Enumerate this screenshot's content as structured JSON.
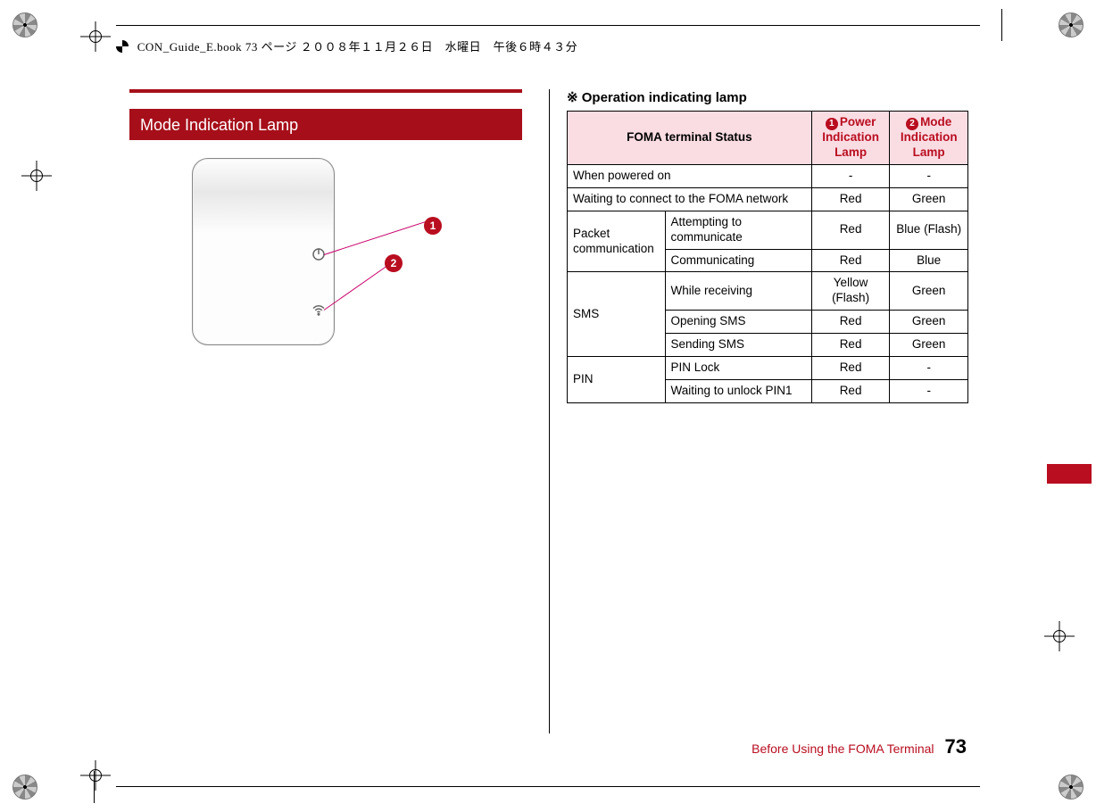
{
  "crop_header": "CON_Guide_E.book  73 ページ  ２００８年１１月２６日　水曜日　午後６時４３分",
  "left": {
    "title": "Mode Indication Lamp",
    "callouts": {
      "one": "1",
      "two": "2"
    }
  },
  "right": {
    "heading": "※ Operation indicating lamp",
    "columns": {
      "status": "FOMA terminal Status",
      "power_badge": "1",
      "power": "Power Indication Lamp",
      "mode_badge": "2",
      "mode": "Mode Indication Lamp"
    },
    "rows": [
      {
        "group": "",
        "status": "When powered on",
        "power": "-",
        "mode": "-"
      },
      {
        "group": "",
        "status": "Waiting to connect to the FOMA network",
        "power": "Red",
        "mode": "Green"
      },
      {
        "group": "Packet communication",
        "status": "Attempting to communicate",
        "power": "Red",
        "mode": "Blue (Flash)"
      },
      {
        "group": "",
        "status": "Communicating",
        "power": "Red",
        "mode": "Blue"
      },
      {
        "group": "SMS",
        "status": "While receiving",
        "power": "Yellow (Flash)",
        "mode": "Green"
      },
      {
        "group": "",
        "status": "Opening SMS",
        "power": "Red",
        "mode": "Green"
      },
      {
        "group": "",
        "status": "Sending SMS",
        "power": "Red",
        "mode": "Green"
      },
      {
        "group": "PIN",
        "status": "PIN Lock",
        "power": "Red",
        "mode": "-"
      },
      {
        "group": "",
        "status": "Waiting to unlock PIN1",
        "power": "Red",
        "mode": "-"
      }
    ]
  },
  "footer": {
    "chapter": "Before Using the FOMA Terminal",
    "page": "73"
  }
}
